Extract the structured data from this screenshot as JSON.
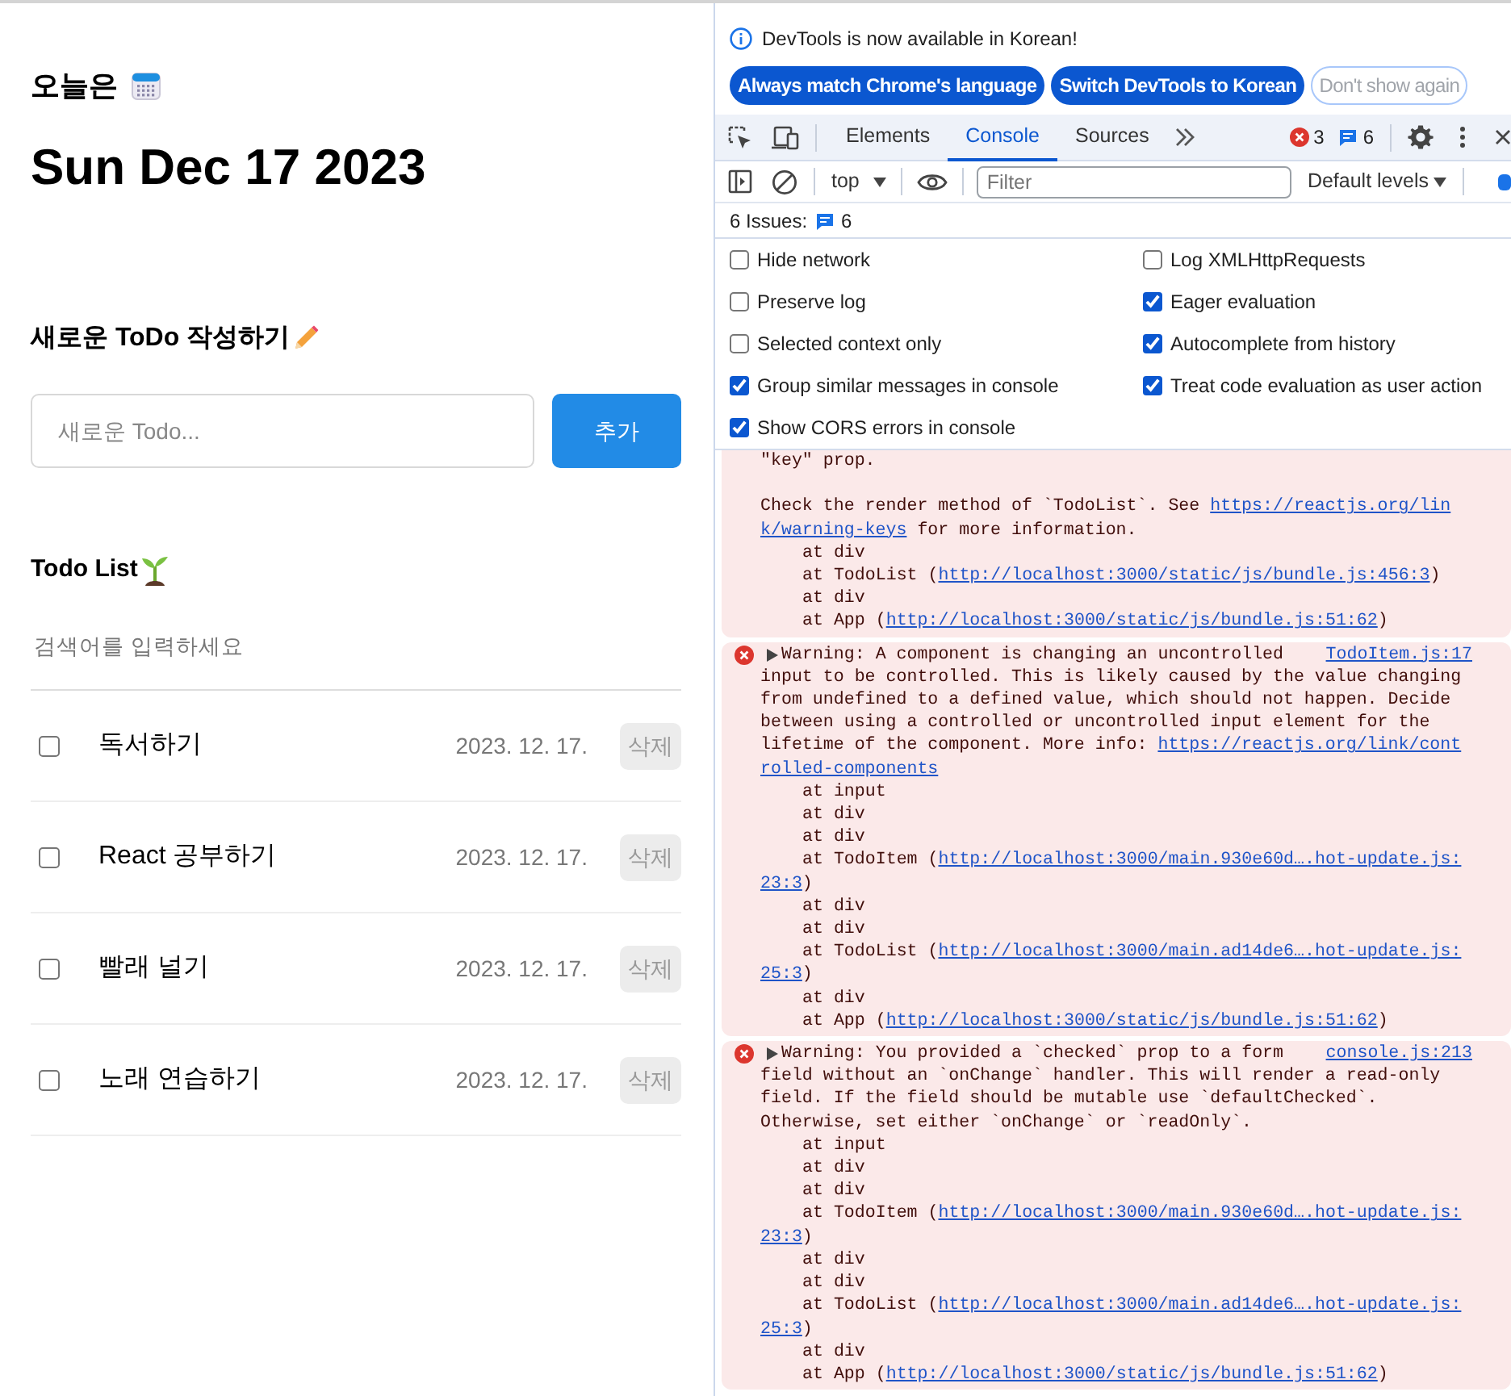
{
  "app": {
    "today_label": "오늘은",
    "date": "Sun Dec 17 2023",
    "editor_title": "새로운 ToDo 작성하기",
    "new_todo": {
      "placeholder": "새로운 Todo..."
    },
    "add_button": "추가",
    "list_title": "Todo List",
    "search": {
      "placeholder": "검색어를 입력하세요"
    },
    "todos": [
      {
        "checked": false,
        "content": "독서하기",
        "date": "2023. 12. 17.",
        "delete_button": "삭제"
      },
      {
        "checked": false,
        "content": "React 공부하기",
        "date": "2023. 12. 17.",
        "delete_button": "삭제"
      },
      {
        "checked": false,
        "content": "빨래 널기",
        "date": "2023. 12. 17.",
        "delete_button": "삭제"
      },
      {
        "checked": false,
        "content": "노래 연습하기",
        "date": "2023. 12. 17.",
        "delete_button": "삭제"
      }
    ]
  },
  "devtools": {
    "banner": {
      "text": "DevTools is now available in Korean!",
      "buttons": [
        {
          "label": "Always match Chrome's language",
          "kind": "primary"
        },
        {
          "label": "Switch DevTools to Korean",
          "kind": "primary"
        },
        {
          "label": "Don't show again",
          "kind": "outline"
        }
      ]
    },
    "tabs": [
      {
        "label": "Elements",
        "selected": false
      },
      {
        "label": "Console",
        "selected": true
      },
      {
        "label": "Sources",
        "selected": false
      }
    ],
    "error_count": "3",
    "message_count": "6",
    "context": "top",
    "filter": {
      "placeholder": "Filter"
    },
    "levels": "Default levels",
    "issues": {
      "label": "6 Issues:",
      "count": "6"
    },
    "settings": [
      {
        "label": "Hide network",
        "checked": false
      },
      {
        "label": "Log XMLHttpRequests",
        "checked": false
      },
      {
        "label": "Preserve log",
        "checked": false
      },
      {
        "label": "Eager evaluation",
        "checked": true
      },
      {
        "label": "Selected context only",
        "checked": false
      },
      {
        "label": "Autocomplete from history",
        "checked": true
      },
      {
        "label": "Group similar messages in console",
        "checked": true
      },
      {
        "label": "Treat code evaluation as user action",
        "checked": true
      },
      {
        "label": "Show CORS errors in console",
        "checked": true
      }
    ],
    "messages": [
      {
        "lines": [
          {
            "segments": [
              {
                "kind": "text",
                "text": "\"key\" prop."
              }
            ]
          },
          {
            "space_before": true,
            "segments": [
              {
                "kind": "text",
                "text": "Check the render method of `TodoList`. See "
              },
              {
                "kind": "link",
                "text": "https://reactjs.org/lin"
              }
            ]
          },
          {
            "segments": [
              {
                "kind": "link",
                "text": "k/warning-keys"
              },
              {
                "kind": "text",
                "text": " for more information."
              }
            ]
          },
          {
            "indent": true,
            "segments": [
              {
                "kind": "text",
                "text": "at div"
              }
            ]
          },
          {
            "indent": true,
            "segments": [
              {
                "kind": "text",
                "text": "at TodoList ("
              },
              {
                "kind": "link",
                "text": "http://localhost:3000/static/js/bundle.js:456:3"
              },
              {
                "kind": "text",
                "text": ")"
              }
            ]
          },
          {
            "indent": true,
            "segments": [
              {
                "kind": "text",
                "text": "at div"
              }
            ]
          },
          {
            "indent": true,
            "segments": [
              {
                "kind": "text",
                "text": "at App ("
              },
              {
                "kind": "link",
                "text": "http://localhost:3000/static/js/bundle.js:51:62"
              },
              {
                "kind": "text",
                "text": ")"
              }
            ]
          }
        ]
      },
      {
        "summary": "Warning: A component is changing an uncontrolled",
        "source": "TodoItem.js:17",
        "lines": [
          {
            "segments": [
              {
                "kind": "text",
                "text": "input to be controlled. This is likely caused by the value changing"
              }
            ]
          },
          {
            "segments": [
              {
                "kind": "text",
                "text": "from undefined to a defined value, which should not happen. Decide"
              }
            ]
          },
          {
            "segments": [
              {
                "kind": "text",
                "text": "between using a controlled or uncontrolled input element for the"
              }
            ]
          },
          {
            "segments": [
              {
                "kind": "text",
                "text": "lifetime of the component. More info: "
              },
              {
                "kind": "link",
                "text": "https://reactjs.org/link/cont"
              }
            ]
          },
          {
            "segments": [
              {
                "kind": "link",
                "text": "rolled-components"
              }
            ]
          },
          {
            "indent": true,
            "segments": [
              {
                "kind": "text",
                "text": "at input"
              }
            ]
          },
          {
            "indent": true,
            "segments": [
              {
                "kind": "text",
                "text": "at div"
              }
            ]
          },
          {
            "indent": true,
            "segments": [
              {
                "kind": "text",
                "text": "at div"
              }
            ]
          },
          {
            "indent": true,
            "segments": [
              {
                "kind": "text",
                "text": "at TodoItem ("
              },
              {
                "kind": "link",
                "text": "http://localhost:3000/main.930e60d….hot-update.js:"
              }
            ]
          },
          {
            "segments": [
              {
                "kind": "link",
                "text": "23:3"
              },
              {
                "kind": "text",
                "text": ")"
              }
            ]
          },
          {
            "indent": true,
            "segments": [
              {
                "kind": "text",
                "text": "at div"
              }
            ]
          },
          {
            "indent": true,
            "segments": [
              {
                "kind": "text",
                "text": "at div"
              }
            ]
          },
          {
            "indent": true,
            "segments": [
              {
                "kind": "text",
                "text": "at TodoList ("
              },
              {
                "kind": "link",
                "text": "http://localhost:3000/main.ad14de6….hot-update.js:"
              }
            ]
          },
          {
            "segments": [
              {
                "kind": "link",
                "text": "25:3"
              },
              {
                "kind": "text",
                "text": ")"
              }
            ]
          },
          {
            "indent": true,
            "segments": [
              {
                "kind": "text",
                "text": "at div"
              }
            ]
          },
          {
            "indent": true,
            "segments": [
              {
                "kind": "text",
                "text": "at App ("
              },
              {
                "kind": "link",
                "text": "http://localhost:3000/static/js/bundle.js:51:62"
              },
              {
                "kind": "text",
                "text": ")"
              }
            ]
          }
        ]
      },
      {
        "summary": "Warning: You provided a `checked` prop to a form",
        "source": "console.js:213",
        "lines": [
          {
            "segments": [
              {
                "kind": "text",
                "text": "field without an `onChange` handler. This will render a read-only"
              }
            ]
          },
          {
            "segments": [
              {
                "kind": "text",
                "text": "field. If the field should be mutable use `defaultChecked`."
              }
            ]
          },
          {
            "segments": [
              {
                "kind": "text",
                "text": "Otherwise, set either `onChange` or `readOnly`."
              }
            ]
          },
          {
            "indent": true,
            "segments": [
              {
                "kind": "text",
                "text": "at input"
              }
            ]
          },
          {
            "indent": true,
            "segments": [
              {
                "kind": "text",
                "text": "at div"
              }
            ]
          },
          {
            "indent": true,
            "segments": [
              {
                "kind": "text",
                "text": "at div"
              }
            ]
          },
          {
            "indent": true,
            "segments": [
              {
                "kind": "text",
                "text": "at TodoItem ("
              },
              {
                "kind": "link",
                "text": "http://localhost:3000/main.930e60d….hot-update.js:"
              }
            ]
          },
          {
            "segments": [
              {
                "kind": "link",
                "text": "23:3"
              },
              {
                "kind": "text",
                "text": ")"
              }
            ]
          },
          {
            "indent": true,
            "segments": [
              {
                "kind": "text",
                "text": "at div"
              }
            ]
          },
          {
            "indent": true,
            "segments": [
              {
                "kind": "text",
                "text": "at div"
              }
            ]
          },
          {
            "indent": true,
            "segments": [
              {
                "kind": "text",
                "text": "at TodoList ("
              },
              {
                "kind": "link",
                "text": "http://localhost:3000/main.ad14de6….hot-update.js:"
              }
            ]
          },
          {
            "segments": [
              {
                "kind": "link",
                "text": "25:3"
              },
              {
                "kind": "text",
                "text": ")"
              }
            ]
          },
          {
            "indent": true,
            "segments": [
              {
                "kind": "text",
                "text": "at div"
              }
            ]
          },
          {
            "indent": true,
            "segments": [
              {
                "kind": "text",
                "text": "at App ("
              },
              {
                "kind": "link",
                "text": "http://localhost:3000/static/js/bundle.js:51:62"
              },
              {
                "kind": "text",
                "text": ")"
              }
            ]
          }
        ]
      }
    ]
  }
}
